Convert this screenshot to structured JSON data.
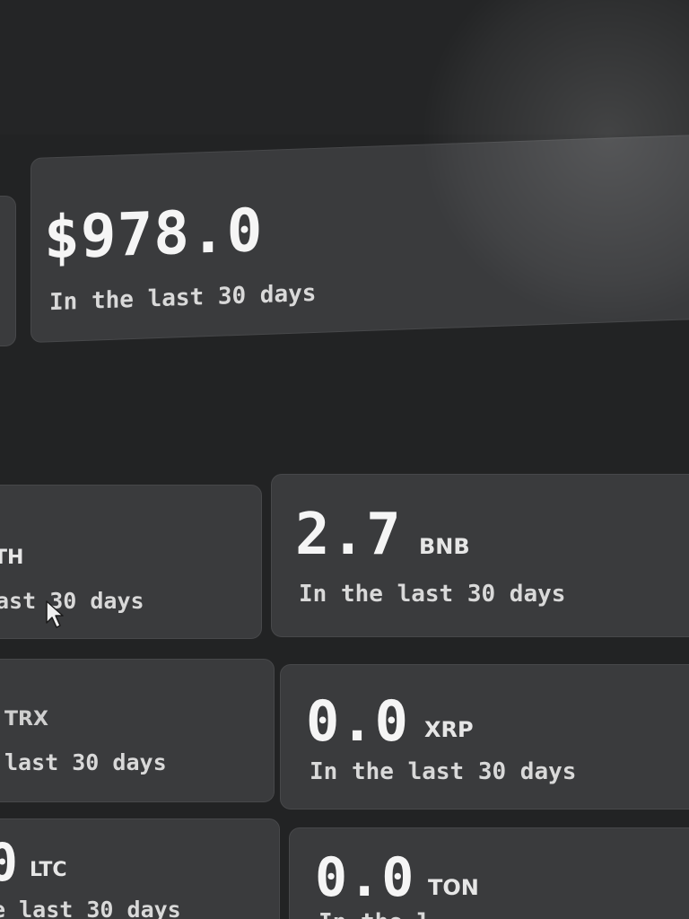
{
  "summary_card": {
    "value": "$978.0",
    "caption": "In the last 30 days"
  },
  "cards": [
    {
      "value": "",
      "unit": "TH",
      "caption": "ast 30 days"
    },
    {
      "value": "2.7",
      "unit": "BNB",
      "caption": "In the last 30 days"
    },
    {
      "value": "",
      "unit": "TRX",
      "caption": "last 30 days"
    },
    {
      "value": "0.0",
      "unit": "XRP",
      "caption": "In the last 30 days"
    },
    {
      "value": "0",
      "unit": "LTC",
      "caption": "e last 30 days"
    },
    {
      "value": "0.0",
      "unit": "TON",
      "caption": "In the l"
    }
  ],
  "icons": {
    "cursor": "mouse-pointer-icon"
  },
  "colors": {
    "background": "#222324",
    "card": "#3a3b3d",
    "text": "#f2f2f2"
  }
}
